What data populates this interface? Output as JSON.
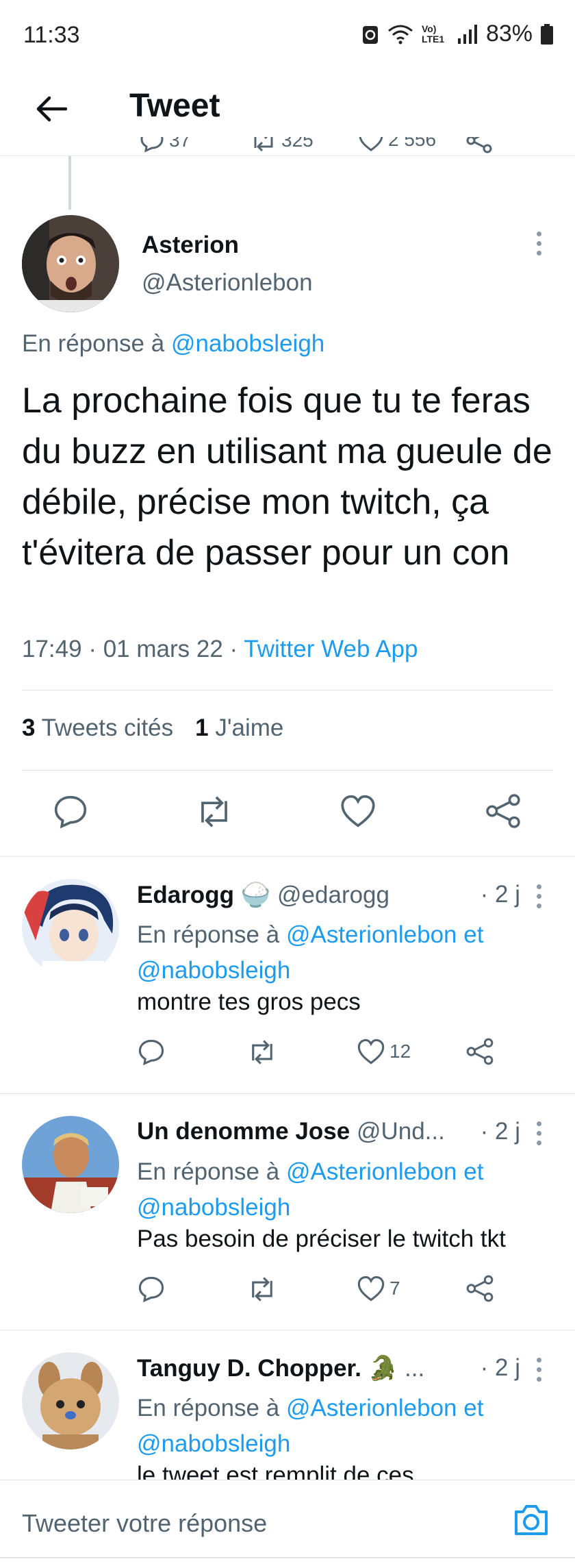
{
  "status_bar": {
    "time": "11:33",
    "volte": "Vo) LTE1",
    "battery": "83%"
  },
  "header": {
    "title": "Tweet"
  },
  "previous_tweet_actions": {
    "replies": "37",
    "retweets": "325",
    "likes": "2 556"
  },
  "main_tweet": {
    "author_name": "Asterion",
    "author_handle": "@Asterionlebon",
    "reply_prefix": "En réponse à",
    "reply_target": "@nabobsleigh",
    "text": "La prochaine fois que tu te feras du buzz en utilisant ma gueule de débile, précise mon twitch, ça t'évitera de passer pour un con",
    "time": "17:49",
    "date": "01 mars 22",
    "source": "Twitter Web App",
    "quote_count": "3",
    "quote_label": "Tweets cités",
    "like_count": "1",
    "like_label": "J'aime"
  },
  "replies": [
    {
      "name": "Edarogg",
      "emoji": "🍚",
      "handle": "@edarogg",
      "time": "· 2 j",
      "reply_prefix": "En réponse à",
      "reply_targets": "@Asterionlebon et",
      "reply_targets_2": "@nabobsleigh",
      "text": "montre tes gros pecs",
      "likes": "12",
      "avatar_color": "#2d4a7a"
    },
    {
      "name": "Un denomme Jose",
      "emoji": "",
      "handle": "@Und...",
      "time": "· 2 j",
      "reply_prefix": "En réponse à",
      "reply_targets": "@Asterionlebon et",
      "reply_targets_2": "@nabobsleigh",
      "text": "Pas besoin de préciser le twitch tkt",
      "likes": "7",
      "avatar_color": "#4a7fb5"
    },
    {
      "name": "Tanguy D. Chopper.",
      "emoji": "🐊 ...",
      "handle": "",
      "time": "· 2 j",
      "reply_prefix": "En réponse à",
      "reply_targets": "@Asterionlebon et",
      "reply_targets_2": "@nabobsleigh",
      "text": "le tweet est remplit de ces",
      "likes": "",
      "avatar_color": "#c9a06a"
    }
  ],
  "compose": {
    "placeholder": "Tweeter votre réponse"
  },
  "colors": {
    "link": "#1d9bf0",
    "secondary": "#536471",
    "divider": "#e1e6ea"
  }
}
